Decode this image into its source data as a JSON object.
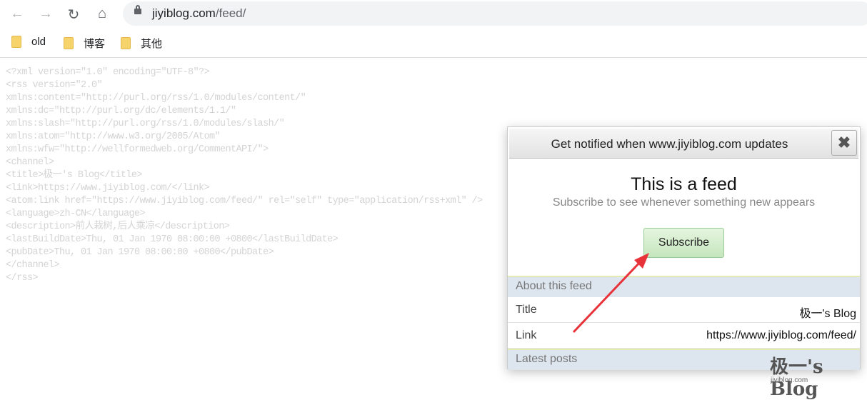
{
  "browser": {
    "url_host": "jiyiblog.com",
    "url_path": "/feed/",
    "bookmarks": [
      "old",
      "博客",
      "其他"
    ]
  },
  "xml_source": [
    "<?xml version=\"1.0\" encoding=\"UTF-8\"?>",
    "<rss version=\"2.0\"",
    "xmlns:content=\"http://purl.org/rss/1.0/modules/content/\"",
    "xmlns:dc=\"http://purl.org/dc/elements/1.1/\"",
    "xmlns:slash=\"http://purl.org/rss/1.0/modules/slash/\"",
    "xmlns:atom=\"http://www.w3.org/2005/Atom\"",
    "xmlns:wfw=\"http://wellformedweb.org/CommentAPI/\">",
    "<channel>",
    "<title>极一's Blog</title>",
    "<link>https://www.jiyiblog.com/</link>",
    "<atom:link href=\"https://www.jiyiblog.com/feed/\" rel=\"self\" type=\"application/rss+xml\" />",
    "<language>zh-CN</language>",
    "<description>前人栽树,后人乘凉</description>",
    "<lastBuildDate>Thu, 01 Jan 1970 08:00:00 +0800</lastBuildDate>",
    "<pubDate>Thu, 01 Jan 1970 08:00:00 +0800</pubDate>",
    "</channel>",
    "</rss>"
  ],
  "popup": {
    "header": "Get notified when www.jiyiblog.com updates",
    "close": "✖",
    "heading": "This is a feed",
    "subheading": "Subscribe to see whenever something new appears",
    "subscribe": "Subscribe",
    "about": "About this feed",
    "title_label": "Title",
    "title_value": "极一's Blog",
    "link_label": "Link",
    "link_value": "https://www.jiyiblog.com/feed/",
    "latest": "Latest posts"
  },
  "watermark": {
    "text": "极一's Blog",
    "sub": "jiyiblog.com"
  },
  "annotation_color": "#e8333a"
}
